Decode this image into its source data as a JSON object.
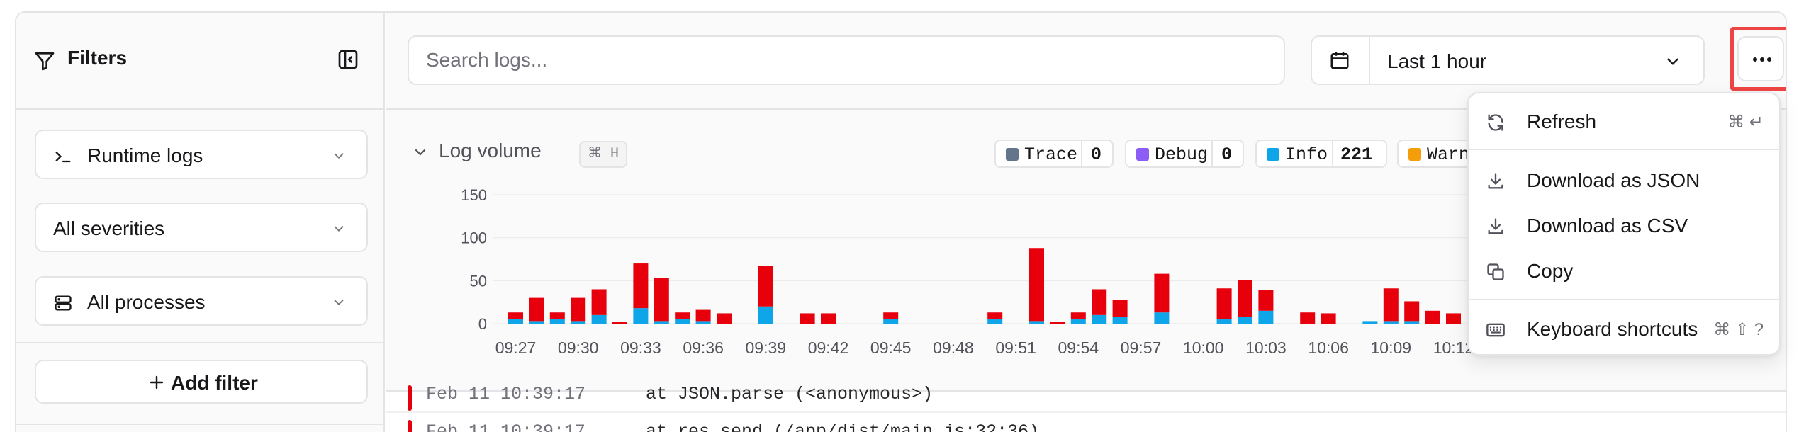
{
  "sidebar": {
    "title": "Filters",
    "selects": [
      {
        "label": "Runtime logs",
        "icon": "terminal-icon"
      },
      {
        "label": "All severities",
        "icon": ""
      },
      {
        "label": "All processes",
        "icon": "server-icon"
      }
    ],
    "add_filter_label": "Add filter"
  },
  "topbar": {
    "search_placeholder": "Search logs...",
    "search_value": "",
    "time_range": "Last 1 hour"
  },
  "volume": {
    "title": "Log volume",
    "shortcut": "⌘ H",
    "legend": [
      {
        "name": "Trace",
        "count": "0",
        "color": "#64748b"
      },
      {
        "name": "Debug",
        "count": "0",
        "color": "#8b5cf6"
      },
      {
        "name": "Info",
        "count": "221",
        "color": "#0ea5e9"
      },
      {
        "name": "Warn",
        "count": "",
        "color": "#f59e0b"
      }
    ]
  },
  "chart_data": {
    "type": "bar",
    "stacked": true,
    "categories": [
      "09:27",
      "09:28",
      "09:29",
      "09:30",
      "09:31",
      "09:32",
      "09:33",
      "09:34",
      "09:35",
      "09:36",
      "09:37",
      "09:38",
      "09:39",
      "09:40",
      "09:41",
      "09:42",
      "09:43",
      "09:44",
      "09:45",
      "09:46",
      "09:47",
      "09:48",
      "09:49",
      "09:50",
      "09:51",
      "09:52",
      "09:53",
      "09:54",
      "09:55",
      "09:56",
      "09:57",
      "09:58",
      "09:59",
      "10:00",
      "10:01",
      "10:02",
      "10:03",
      "10:04",
      "10:05",
      "10:06",
      "10:07",
      "10:08",
      "10:09",
      "10:10",
      "10:11",
      "10:12",
      "10:13"
    ],
    "x_tick_labels": [
      "09:27",
      "09:30",
      "09:33",
      "09:36",
      "09:39",
      "09:42",
      "09:45",
      "09:48",
      "09:51",
      "09:54",
      "09:57",
      "10:00",
      "10:03",
      "10:06",
      "10:09",
      "10:12"
    ],
    "series": [
      {
        "name": "Info",
        "color": "#0ea5e9",
        "values": [
          5,
          3,
          5,
          3,
          10,
          0,
          18,
          3,
          5,
          3,
          0,
          0,
          20,
          0,
          0,
          0,
          0,
          0,
          5,
          0,
          0,
          0,
          0,
          5,
          0,
          3,
          0,
          5,
          10,
          8,
          0,
          13,
          0,
          0,
          5,
          8,
          15,
          0,
          0,
          0,
          0,
          3,
          3,
          3,
          0,
          0,
          0
        ]
      },
      {
        "name": "Error",
        "color": "#e7000b",
        "values": [
          8,
          27,
          8,
          27,
          30,
          2,
          52,
          50,
          8,
          13,
          12,
          0,
          47,
          0,
          12,
          12,
          0,
          0,
          8,
          0,
          0,
          0,
          0,
          8,
          0,
          85,
          2,
          8,
          30,
          20,
          0,
          45,
          0,
          0,
          36,
          43,
          24,
          0,
          13,
          12,
          0,
          0,
          38,
          23,
          15,
          12,
          0
        ]
      }
    ],
    "ylim": [
      0,
      150
    ],
    "y_ticks": [
      0,
      50,
      100,
      150
    ],
    "grid": true
  },
  "logs": [
    {
      "timestamp": "Feb 11 10:39:17",
      "message": "at JSON.parse (<anonymous>)"
    },
    {
      "timestamp": "Feb 11 10:39:17",
      "message": "at res.send (/app/dist/main.js:32:36)"
    }
  ],
  "menu": {
    "items": [
      {
        "label": "Refresh",
        "shortcut": "⌘ ↵",
        "icon": "refresh-icon"
      },
      {
        "label": "Download as JSON",
        "shortcut": "",
        "icon": "download-icon"
      },
      {
        "label": "Download as CSV",
        "shortcut": "",
        "icon": "download-icon"
      },
      {
        "label": "Copy",
        "shortcut": "",
        "icon": "copy-icon"
      },
      {
        "label": "Keyboard shortcuts",
        "shortcut": "⌘ ⇧ ?",
        "icon": "keyboard-icon"
      }
    ]
  }
}
